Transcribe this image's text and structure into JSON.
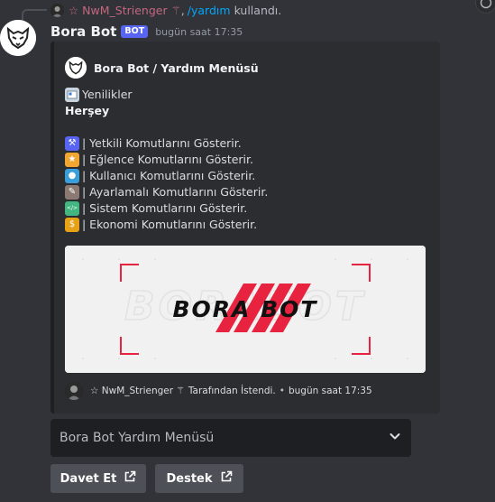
{
  "reply": {
    "username": "☆ NwM_Strienger ⚚",
    "separator": ",",
    "command": "/yardım",
    "suffix": "kullandı."
  },
  "message": {
    "author": "Bora Bot",
    "badge": "BOT",
    "timestamp": "bugün saat 17:35"
  },
  "embed": {
    "author_name": "Bora Bot / Yardım Menüsü",
    "news_label": "Yenilikler",
    "bold_line": "Herşey",
    "items": [
      {
        "icon": "hammer-wrench-icon",
        "text": "| Yetkili Komutlarını Gösterir.",
        "color": "#5865f2"
      },
      {
        "icon": "star-icon",
        "text": "| Eğlence Komutlarını Gösterir.",
        "color": "#f0a630"
      },
      {
        "icon": "users-icon",
        "text": "| Kullanıcı Komutlarını Gösterir.",
        "color": "#3a9ed8"
      },
      {
        "icon": "wrench-icon",
        "text": "| Ayarlamalı Komutlarını Gösterir.",
        "color": "#8a7a72"
      },
      {
        "icon": "code-icon",
        "text": "| Sistem Komutlarını Gösterir.",
        "color": "#43b581"
      },
      {
        "icon": "money-bag-icon",
        "text": "| Ekonomi Komutlarını Gösterir.",
        "color": "#e6a117"
      }
    ],
    "image_text": "BORA BOT",
    "image_watermark": "BORABOT",
    "footer_user": "☆ NwM_Strienger ⚚",
    "footer_text": "Tarafından İstendi.",
    "footer_sep": "•",
    "footer_time": "bugün saat 17:35"
  },
  "select": {
    "placeholder": "Bora Bot Yardım Menüsü"
  },
  "buttons": {
    "invite": "Davet Et",
    "support": "Destek"
  },
  "colors": {
    "background": "#313338",
    "embed_bg": "#2b2d31",
    "accent": "#5865f2",
    "brand_red": "#e8233f",
    "link": "#00a8fc"
  }
}
